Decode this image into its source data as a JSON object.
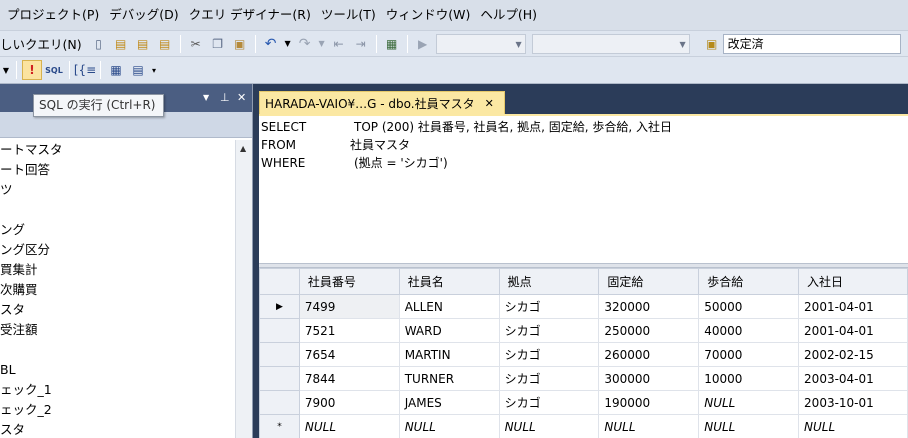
{
  "menu": [
    "プロジェクト(P)",
    "デバッグ(D)",
    "クエリ デザイナー(R)",
    "ツール(T)",
    "ウィンドウ(W)",
    "ヘルプ(H)"
  ],
  "toolbar": {
    "new_query_label": "しいクエリ(N)",
    "change_type_value": "改定済"
  },
  "tooltip": "SQL の実行 (Ctrl+R)",
  "tree_items": [
    "ートマスタ",
    "ート回答",
    "ツ",
    "",
    "ング",
    "ング区分",
    "買集計",
    "次購買",
    "スタ",
    "受注額",
    "",
    "BL",
    "ェック_1",
    "ェック_2",
    "スタ"
  ],
  "tab": {
    "title": "HARADA-VAIO¥…G - dbo.社員マスタ",
    "close": "✕"
  },
  "sql": [
    {
      "kw": "SELECT",
      "body": "TOP (200) 社員番号, 社員名, 拠点, 固定給, 歩合給, 入社日"
    },
    {
      "kw": "FROM",
      "body": "社員マスタ"
    },
    {
      "kw": "WHERE",
      "body": "(拠点 = 'シカゴ')"
    }
  ],
  "grid": {
    "columns": [
      "社員番号",
      "社員名",
      "拠点",
      "固定給",
      "歩合給",
      "入社日"
    ],
    "rows": [
      [
        "7499",
        "ALLEN",
        "シカゴ",
        "320000",
        "50000",
        "2001-04-01"
      ],
      [
        "7521",
        "WARD",
        "シカゴ",
        "250000",
        "40000",
        "2001-04-01"
      ],
      [
        "7654",
        "MARTIN",
        "シカゴ",
        "260000",
        "70000",
        "2002-02-15"
      ],
      [
        "7844",
        "TURNER",
        "シカゴ",
        "300000",
        "10000",
        "2003-04-01"
      ],
      [
        "7900",
        "JAMES",
        "シカゴ",
        "190000",
        "NULL",
        "2003-10-01"
      ],
      [
        "NULL",
        "NULL",
        "NULL",
        "NULL",
        "NULL",
        "NULL"
      ]
    ],
    "current_row_marker": "▶",
    "new_row_marker": "*"
  }
}
